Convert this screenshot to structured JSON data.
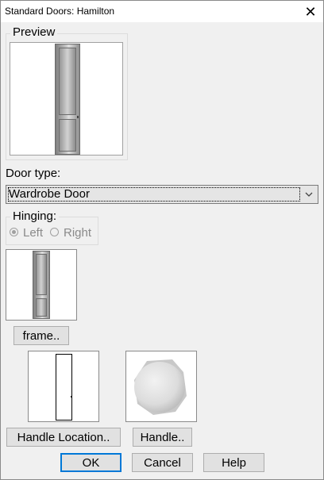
{
  "window": {
    "title": "Standard Doors: Hamilton",
    "close_glyph": "✕"
  },
  "preview": {
    "label": "Preview"
  },
  "door_type": {
    "label": "Door type:",
    "selected": "Wardrobe Door"
  },
  "hinging": {
    "label": "Hinging:",
    "options": [
      {
        "label": "Left",
        "checked": true,
        "enabled": false
      },
      {
        "label": "Right",
        "checked": false,
        "enabled": false
      }
    ]
  },
  "buttons": {
    "frame": "frame..",
    "handle_location": "Handle Location..",
    "handle": "Handle..",
    "ok": "OK",
    "cancel": "Cancel",
    "help": "Help"
  },
  "colors": {
    "background": "#f0f0f0",
    "default_button_border": "#0078d7",
    "disabled_text": "#8a8a8a"
  }
}
